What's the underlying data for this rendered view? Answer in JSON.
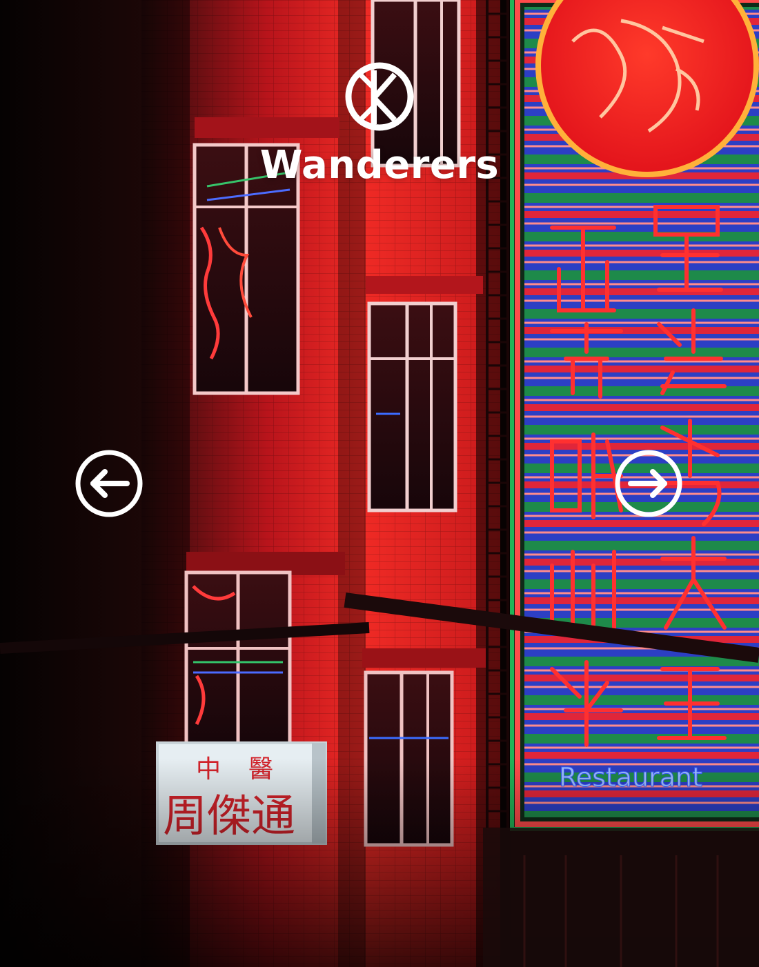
{
  "brand": {
    "name": "Wanderers",
    "logo_icon": "circle-branch-logo"
  },
  "gallery": {
    "prev_icon": "arrow-left-circle-icon",
    "next_icon": "arrow-right-circle-icon",
    "hero_image": {
      "subject": "neon-lit street facade at night",
      "sign_small_line1": "中  醫",
      "sign_small_line2": "周傑通",
      "neon_col_left": [
        "正",
        "宗",
        "潮",
        "州",
        "粉"
      ],
      "neon_col_right": [
        "墨",
        "魚",
        "丸",
        "大",
        "王"
      ],
      "neon_banner_text": "Restaurant"
    }
  },
  "colors": {
    "overlay_white": "#ffffff",
    "neon_red": "#ff2a2a",
    "neon_green": "#1f9a4e",
    "neon_blue": "#3a4fd8",
    "facade_red": "#d7151c",
    "shadow_dark": "#0a0506"
  }
}
